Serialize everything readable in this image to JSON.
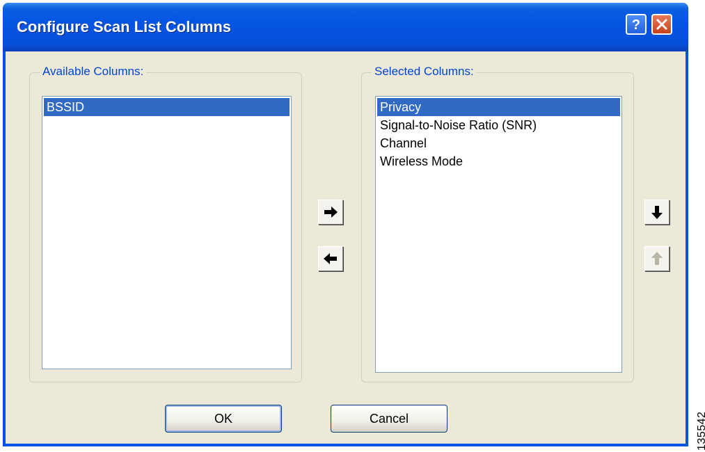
{
  "window": {
    "title": "Configure Scan List Columns",
    "help_icon": "question-mark",
    "close_icon": "x-mark"
  },
  "available": {
    "label": "Available Columns:",
    "items": [
      "BSSID"
    ],
    "selected_index": 0
  },
  "selected": {
    "label": "Selected Columns:",
    "items": [
      "Privacy",
      "Signal-to-Noise Ratio (SNR)",
      "Channel",
      "Wireless Mode"
    ],
    "selected_index": 0
  },
  "transfer_buttons": {
    "add_icon": "arrow-right",
    "remove_icon": "arrow-left"
  },
  "order_buttons": {
    "down_icon": "arrow-down",
    "up_icon": "arrow-up",
    "up_enabled": false
  },
  "footer": {
    "ok_label": "OK",
    "cancel_label": "Cancel"
  },
  "figure_id": "135542",
  "colors": {
    "title_bar": "#0054e3",
    "selection": "#316ac5",
    "dialog_bg": "#ece9d8",
    "group_label": "#0046d5"
  }
}
